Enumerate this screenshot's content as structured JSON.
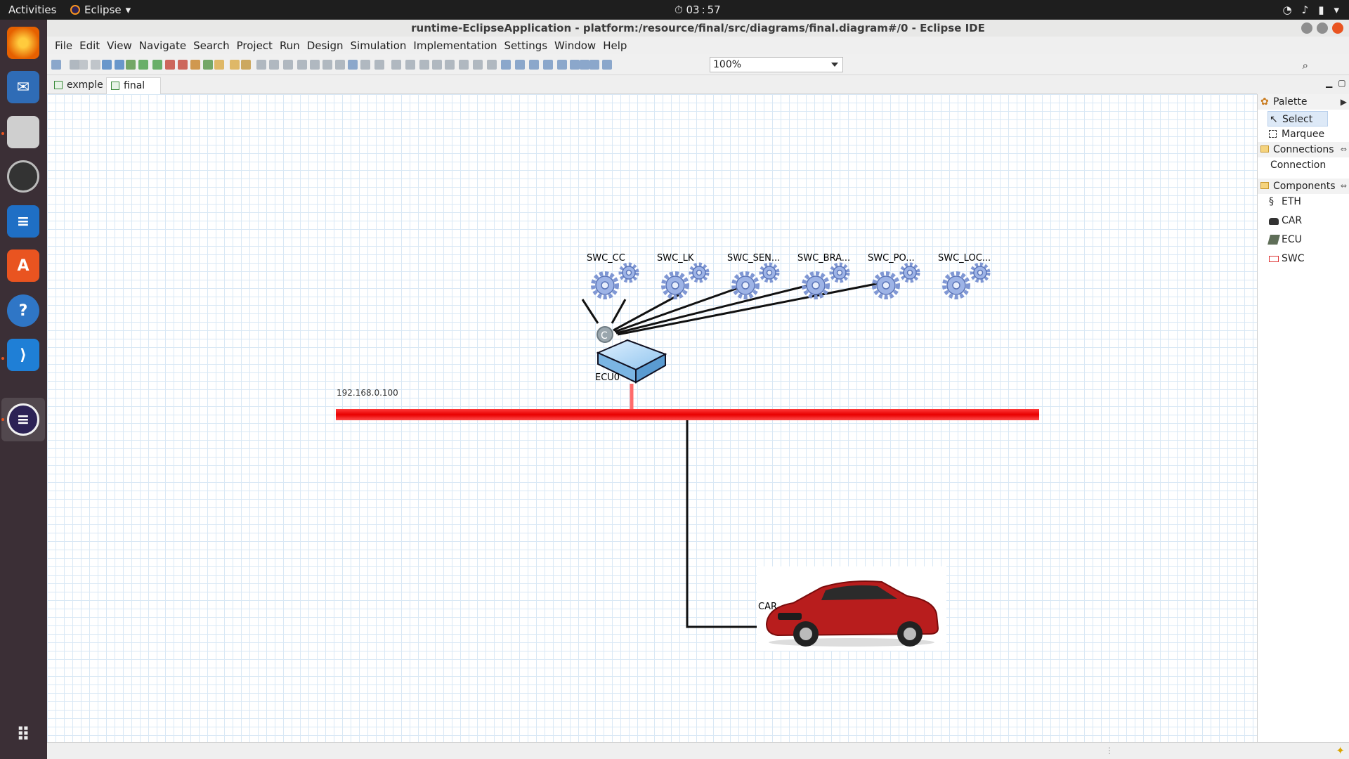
{
  "topbar": {
    "activities": "Activities",
    "app_name": "Eclipse",
    "clock": "03 : 57"
  },
  "window": {
    "title": "runtime-EclipseApplication - platform:/resource/final/src/diagrams/final.diagram#/0 - Eclipse IDE"
  },
  "menu": [
    "File",
    "Edit",
    "View",
    "Navigate",
    "Search",
    "Project",
    "Run",
    "Design",
    "Simulation",
    "Implementation",
    "Settings",
    "Window",
    "Help"
  ],
  "toolbar": {
    "zoom": "100%"
  },
  "tabs": [
    {
      "label": "exmple"
    },
    {
      "label": "final"
    }
  ],
  "diagram": {
    "swcs": [
      "SWC_CC",
      "SWC_LK",
      "SWC_SEN...",
      "SWC_BRA...",
      "SWC_PO...",
      "SWC_LOC..."
    ],
    "connector_label": "C",
    "ecu_label": "ECU0",
    "network_address": "192.168.0.100",
    "car_label": "CAR",
    "colors": {
      "network": "#ff0000",
      "grid": "#d9e8f5",
      "ecu": "#9cccf0"
    }
  },
  "palette": {
    "title": "Palette",
    "tools": [
      "Select",
      "Marquee"
    ],
    "connections_title": "Connections",
    "connections": [
      "Connection"
    ],
    "components_title": "Components",
    "components": [
      "ETH",
      "CAR",
      "ECU",
      "SWC"
    ]
  }
}
